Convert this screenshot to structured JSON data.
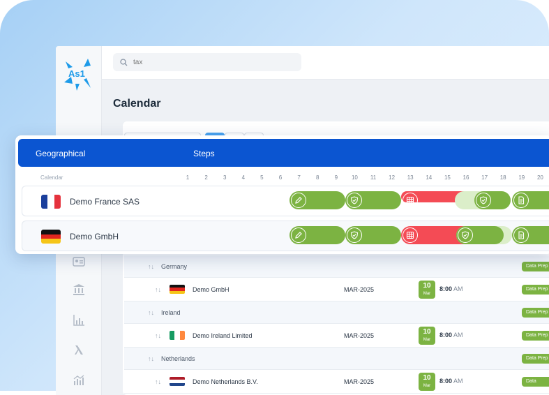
{
  "search": {
    "placeholder": "tax"
  },
  "logo": {
    "text": "As1"
  },
  "page": {
    "title": "Calendar"
  },
  "overlay": {
    "header": {
      "col1": "Geographical",
      "col2": "Steps"
    },
    "calendar_label": "Calendar",
    "days": [
      "1",
      "2",
      "3",
      "4",
      "5",
      "6",
      "7",
      "8",
      "9",
      "10",
      "11",
      "12",
      "13",
      "14",
      "15",
      "16",
      "17",
      "18",
      "19",
      "20"
    ],
    "rows": [
      {
        "name": "Demo France SAS",
        "flag": "france"
      },
      {
        "name": "Demo GmbH",
        "flag": "germany"
      }
    ]
  },
  "list": {
    "groups": [
      {
        "country": "Germany",
        "company": "Demo GmbH",
        "flag": "germany",
        "period": "MAR-2025",
        "day": "10",
        "month": "Mar",
        "time": "8:00",
        "ampm": "AM",
        "tag": "Data Prep"
      },
      {
        "country": "Ireland",
        "company": "Demo Ireland Limited",
        "flag": "ireland",
        "period": "MAR-2025",
        "day": "10",
        "month": "Mar",
        "time": "8:00",
        "ampm": "AM",
        "tag": "Data Prep"
      },
      {
        "country": "Netherlands",
        "company": "Demo Netherlands B.V.",
        "flag": "netherlands",
        "period": "MAR-2025",
        "day": "10",
        "month": "Mar",
        "time": "8:00",
        "ampm": "AM",
        "tag": "Data"
      }
    ],
    "group_tag": "Data Prep"
  },
  "colors": {
    "header_blue": "#0b55d1",
    "green": "#7cb342",
    "red": "#f44b55",
    "light_green": "#dbeec9"
  },
  "icons": [
    "search-icon",
    "logo-icon",
    "contact-card-icon",
    "bank-icon",
    "bar-chart-icon",
    "lambda-icon",
    "analytics-icon",
    "edit-icon",
    "shield-check-icon",
    "table-icon",
    "document-icon",
    "sort-icon"
  ]
}
